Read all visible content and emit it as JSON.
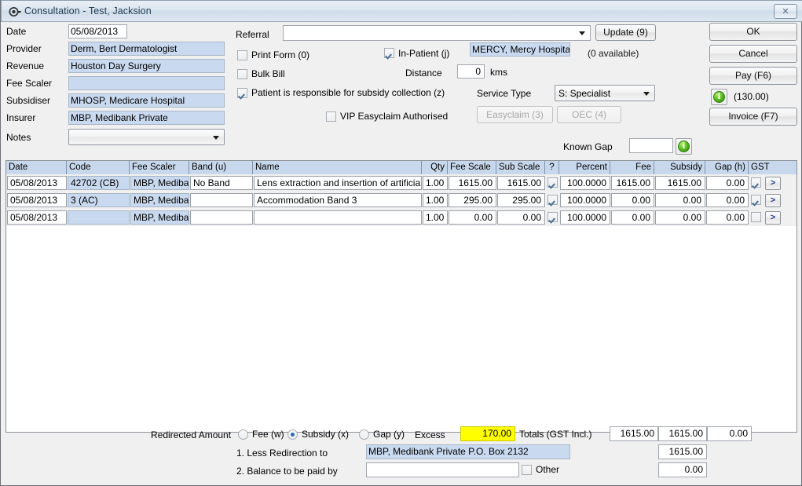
{
  "window": {
    "title": "Consultation - Test, Jacksion",
    "close_label": "✕",
    "title_icon": "consultation-icon"
  },
  "left_form": {
    "rows": [
      {
        "label": "Date",
        "value": "05/08/2013",
        "style": "white"
      },
      {
        "label": "Provider",
        "value": "Derm, Bert  Dermatologist",
        "style": "blue"
      },
      {
        "label": "Revenue",
        "value": "Houston Day Surgery",
        "style": "blue"
      },
      {
        "label": "Fee Scaler",
        "value": "",
        "style": "blue"
      },
      {
        "label": "Subsidiser",
        "value": "MHOSP, Medicare Hospital",
        "style": "blue"
      },
      {
        "label": "Insurer",
        "value": "MBP, Medibank Private",
        "style": "blue"
      }
    ],
    "notes_label": "Notes",
    "notes_value": ""
  },
  "middle_form": {
    "referral_label": "Referral",
    "referral_value": "",
    "update_button": "Update (9)",
    "available_text": "(0 available)",
    "print_form": {
      "label": "Print Form (0)",
      "checked": false
    },
    "bulk_bill": {
      "label": "Bulk Bill",
      "checked": false
    },
    "patient_responsible": {
      "label": "Patient is responsible for subsidy collection (z)",
      "checked": true
    },
    "vip_easyclaim": {
      "label": "VIP Easyclaim Authorised",
      "checked": false
    },
    "in_patient": {
      "label": "In-Patient (j)",
      "checked": true
    },
    "hospital_value": "MERCY, Mercy Hospital",
    "distance_label": "Distance",
    "distance_value": "0",
    "kms_label": "kms",
    "service_type_label": "Service Type",
    "service_type_value": "S: Specialist",
    "easyclaim_button": "Easyclaim (3)",
    "oec_button": "OEC (4)",
    "known_gap_label": "Known Gap",
    "known_gap_value": ""
  },
  "right_buttons": {
    "ok": "OK",
    "cancel": "Cancel",
    "pay": "Pay (F6)",
    "amount": "(130.00)",
    "invoice": "Invoice (F7)",
    "info_glyph": "i"
  },
  "grid": {
    "columns": [
      "Date",
      "Code",
      "Fee Scaler",
      "Band (u)",
      "Name",
      "Qty",
      "Fee Scale",
      "Sub Scale",
      "?",
      "Percent",
      "Fee",
      "Subsidy",
      "Gap (h)",
      "GST"
    ],
    "rows": [
      {
        "date": "05/08/2013",
        "code": "42702 (CB)",
        "fee_scaler": "MBP, Medibank",
        "band": "No Band",
        "name": "Lens extraction and insertion of artificial le",
        "qty": "1.00",
        "fee_scale": "1615.00",
        "sub_scale": "1615.00",
        "q_checked": true,
        "percent": "100.0000",
        "fee": "1615.00",
        "subsidy": "1615.00",
        "gap": "0.00",
        "gst_checked": true,
        "chevron": ">"
      },
      {
        "date": "05/08/2013",
        "code": "3 (AC)",
        "fee_scaler": "MBP, Medibank",
        "band": "",
        "name": "Accommodation Band 3",
        "qty": "1.00",
        "fee_scale": "295.00",
        "sub_scale": "295.00",
        "q_checked": true,
        "percent": "100.0000",
        "fee": "0.00",
        "subsidy": "0.00",
        "gap": "0.00",
        "gst_checked": true,
        "chevron": ">"
      },
      {
        "date": "05/08/2013",
        "code": "",
        "fee_scaler": "MBP, Medibank",
        "band": "",
        "name": "",
        "qty": "1.00",
        "fee_scale": "0.00",
        "sub_scale": "0.00",
        "q_checked": true,
        "percent": "100.0000",
        "fee": "0.00",
        "subsidy": "0.00",
        "gap": "0.00",
        "gst_checked": false,
        "chevron": ">"
      }
    ]
  },
  "footer": {
    "redirected_amount_label": "Redirected Amount",
    "radio_fee": {
      "label": "Fee (w)",
      "checked": false
    },
    "radio_subsidy": {
      "label": "Subsidy (x)",
      "checked": true
    },
    "radio_gap": {
      "label": "Gap (y)",
      "checked": false
    },
    "excess_label": "Excess",
    "excess_value": "170.00",
    "totals_label": "Totals (GST Incl.)",
    "total_1": "1615.00",
    "total_2": "1615.00",
    "total_3": "0.00",
    "less_redirection_label": "1. Less Redirection to",
    "less_redirection_value": "MBP, Medibank Private P.O. Box 2132",
    "less_redirection_amount": "1615.00",
    "balance_label": "2. Balance to be paid by",
    "balance_value": "",
    "other_label": "Other",
    "other_checked": false,
    "balance_amount": "0.00"
  },
  "colors": {
    "field_blue": "#c9d9ef",
    "header_blue": "#c8d8ec",
    "highlight_yellow": "#ffff00",
    "window_bg": "#f0f0f0",
    "title_text": "#1f3a52"
  }
}
